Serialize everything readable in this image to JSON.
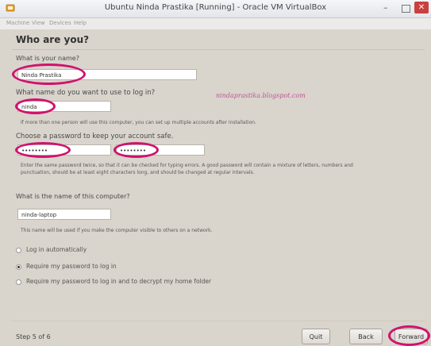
{
  "window": {
    "title": "Ubuntu Ninda Prastika [Running] - Oracle VM VirtualBox",
    "close_glyph": "✕",
    "min_glyph": "–"
  },
  "menu": [
    "Machine",
    "View",
    "Devices",
    "Help"
  ],
  "page": {
    "heading": "Who are you?"
  },
  "form": {
    "name_label": "What is your name?",
    "name_value": "Ninda Prastika",
    "login_label": "What name do you want to use to log in?",
    "login_value": "ninda",
    "login_hint": "If more than one person will use this computer, you can set up multiple accounts after installation.",
    "password_label": "Choose a password to keep your account safe.",
    "password_value": "••••••••",
    "confirm_value": "••••••••",
    "password_hint": "Enter the same password twice, so that it can be checked for typing errors. A good password will contain a mixture of letters, numbers and punctuation, should be at least eight characters long, and should be changed at regular intervals.",
    "computer_label": "What is the name of this computer?",
    "computer_value": "ninda-laptop",
    "computer_hint": "This name will be used if you make the computer visible to others on a network."
  },
  "watermark": "nindaprastika.blogspot.com",
  "options": [
    {
      "label": "Log in automatically",
      "selected": false
    },
    {
      "label": "Require my password to log in",
      "selected": true
    },
    {
      "label": "Require my password to log in and to decrypt my home folder",
      "selected": false
    }
  ],
  "footer": {
    "step": "Step 5 of 6",
    "quit": "Quit",
    "back": "Back",
    "forward": "Forward"
  },
  "colors": {
    "highlight": "#d0126e",
    "background": "#d9d4cc"
  }
}
